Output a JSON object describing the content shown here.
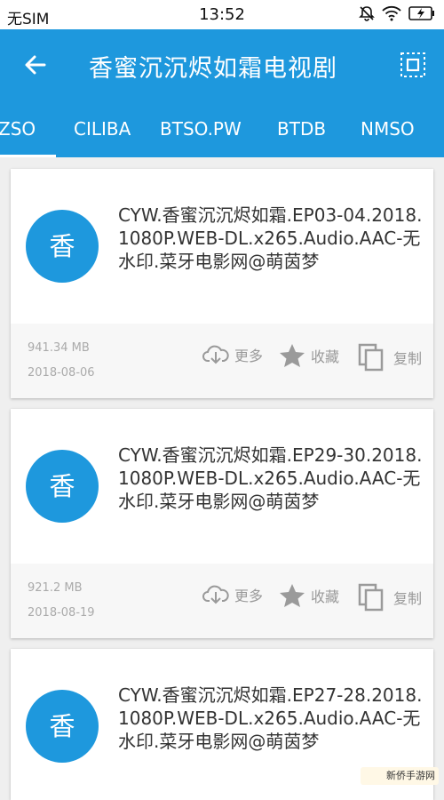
{
  "status_bar": {
    "carrier": "无SIM",
    "time": "13:52"
  },
  "app_bar": {
    "title": "香蜜沉沉烬如霜电视剧"
  },
  "tabs": [
    {
      "label": "ZSO"
    },
    {
      "label": "CILIBA"
    },
    {
      "label": "BTSO.PW"
    },
    {
      "label": "BTDB"
    },
    {
      "label": "NMSO"
    }
  ],
  "cards": [
    {
      "avatar": "香",
      "title": "CYW.香蜜沉沉烬如霜.EP03-04.2018.1080P.WEB-DL.x265.Audio.AAC-无水印.菜牙电影网@萌茵梦",
      "size": "941.34 MB",
      "date": "2018-08-06",
      "more_label": "更多",
      "favorite_label": "收藏",
      "copy_label": "复制"
    },
    {
      "avatar": "香",
      "title": "CYW.香蜜沉沉烬如霜.EP29-30.2018.1080P.WEB-DL.x265.Audio.AAC-无水印.菜牙电影网@萌茵梦",
      "size": "921.2 MB",
      "date": "2018-08-19",
      "more_label": "更多",
      "favorite_label": "收藏",
      "copy_label": "复制"
    },
    {
      "avatar": "香",
      "title": "CYW.香蜜沉沉烬如霜.EP27-28.2018.1080P.WEB-DL.x265.Audio.AAC-无水印.菜牙电影网@萌茵梦"
    }
  ],
  "watermark": {
    "text": "新侨手游网"
  },
  "colors": {
    "primary": "#1e98dd",
    "card_footer": "#f7f7f7",
    "muted_text": "#9a9a9a"
  }
}
